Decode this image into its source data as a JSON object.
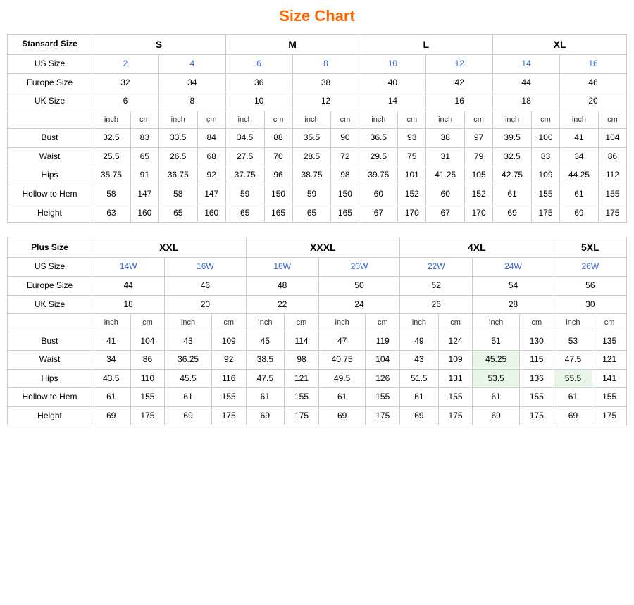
{
  "title": "Size Chart",
  "standard": {
    "section_label": "Stansard Size",
    "size_groups": [
      "S",
      "M",
      "L",
      "XL"
    ],
    "us_label": "US Size",
    "eu_label": "Europe Size",
    "uk_label": "UK Size",
    "us_sizes": [
      "2",
      "4",
      "6",
      "8",
      "10",
      "12",
      "14",
      "16"
    ],
    "eu_sizes": [
      "32",
      "34",
      "36",
      "38",
      "40",
      "42",
      "44",
      "46"
    ],
    "uk_sizes": [
      "6",
      "8",
      "10",
      "12",
      "14",
      "16",
      "18",
      "20"
    ],
    "unit_row": [
      "inch",
      "cm",
      "inch",
      "cm",
      "inch",
      "cm",
      "inch",
      "cm",
      "inch",
      "cm",
      "inch",
      "cm",
      "inch",
      "cm",
      "inch",
      "cm"
    ],
    "rows": [
      {
        "label": "Bust",
        "vals": [
          "32.5",
          "83",
          "33.5",
          "84",
          "34.5",
          "88",
          "35.5",
          "90",
          "36.5",
          "93",
          "38",
          "97",
          "39.5",
          "100",
          "41",
          "104"
        ]
      },
      {
        "label": "Waist",
        "vals": [
          "25.5",
          "65",
          "26.5",
          "68",
          "27.5",
          "70",
          "28.5",
          "72",
          "29.5",
          "75",
          "31",
          "79",
          "32.5",
          "83",
          "34",
          "86"
        ]
      },
      {
        "label": "Hips",
        "vals": [
          "35.75",
          "91",
          "36.75",
          "92",
          "37.75",
          "96",
          "38.75",
          "98",
          "39.75",
          "101",
          "41.25",
          "105",
          "42.75",
          "109",
          "44.25",
          "112"
        ]
      },
      {
        "label": "Hollow to Hem",
        "vals": [
          "58",
          "147",
          "58",
          "147",
          "59",
          "150",
          "59",
          "150",
          "60",
          "152",
          "60",
          "152",
          "61",
          "155",
          "61",
          "155"
        ]
      },
      {
        "label": "Height",
        "vals": [
          "63",
          "160",
          "65",
          "160",
          "65",
          "165",
          "65",
          "165",
          "67",
          "170",
          "67",
          "170",
          "69",
          "175",
          "69",
          "175"
        ]
      }
    ]
  },
  "plus": {
    "section_label": "Plus Size",
    "size_groups": [
      "XXL",
      "XXXL",
      "4XL",
      "5XL"
    ],
    "us_label": "US Size",
    "eu_label": "Europe Size",
    "uk_label": "UK Size",
    "us_sizes": [
      "14W",
      "16W",
      "18W",
      "20W",
      "22W",
      "24W",
      "26W"
    ],
    "eu_sizes": [
      "44",
      "46",
      "48",
      "50",
      "52",
      "54",
      "56"
    ],
    "uk_sizes": [
      "18",
      "20",
      "22",
      "24",
      "26",
      "28",
      "30"
    ],
    "unit_row": [
      "inch",
      "cm",
      "inch",
      "cm",
      "inch",
      "cm",
      "inch",
      "cm",
      "inch",
      "cm",
      "inch",
      "cm",
      "inch",
      "cm"
    ],
    "rows": [
      {
        "label": "Bust",
        "vals": [
          "41",
          "104",
          "43",
          "109",
          "45",
          "114",
          "47",
          "119",
          "49",
          "124",
          "51",
          "130",
          "53",
          "135"
        ]
      },
      {
        "label": "Waist",
        "vals": [
          "34",
          "86",
          "36.25",
          "92",
          "38.5",
          "98",
          "40.75",
          "104",
          "43",
          "109",
          "45.25",
          "115",
          "47.5",
          "121"
        ]
      },
      {
        "label": "Hips",
        "vals": [
          "43.5",
          "110",
          "45.5",
          "116",
          "47.5",
          "121",
          "49.5",
          "126",
          "51.5",
          "131",
          "53.5",
          "136",
          "55.5",
          "141"
        ]
      },
      {
        "label": "Hollow to Hem",
        "vals": [
          "61",
          "155",
          "61",
          "155",
          "61",
          "155",
          "61",
          "155",
          "61",
          "155",
          "61",
          "155",
          "61",
          "155"
        ]
      },
      {
        "label": "Height",
        "vals": [
          "69",
          "175",
          "69",
          "175",
          "69",
          "175",
          "69",
          "175",
          "69",
          "175",
          "69",
          "175",
          "69",
          "175"
        ]
      }
    ]
  }
}
